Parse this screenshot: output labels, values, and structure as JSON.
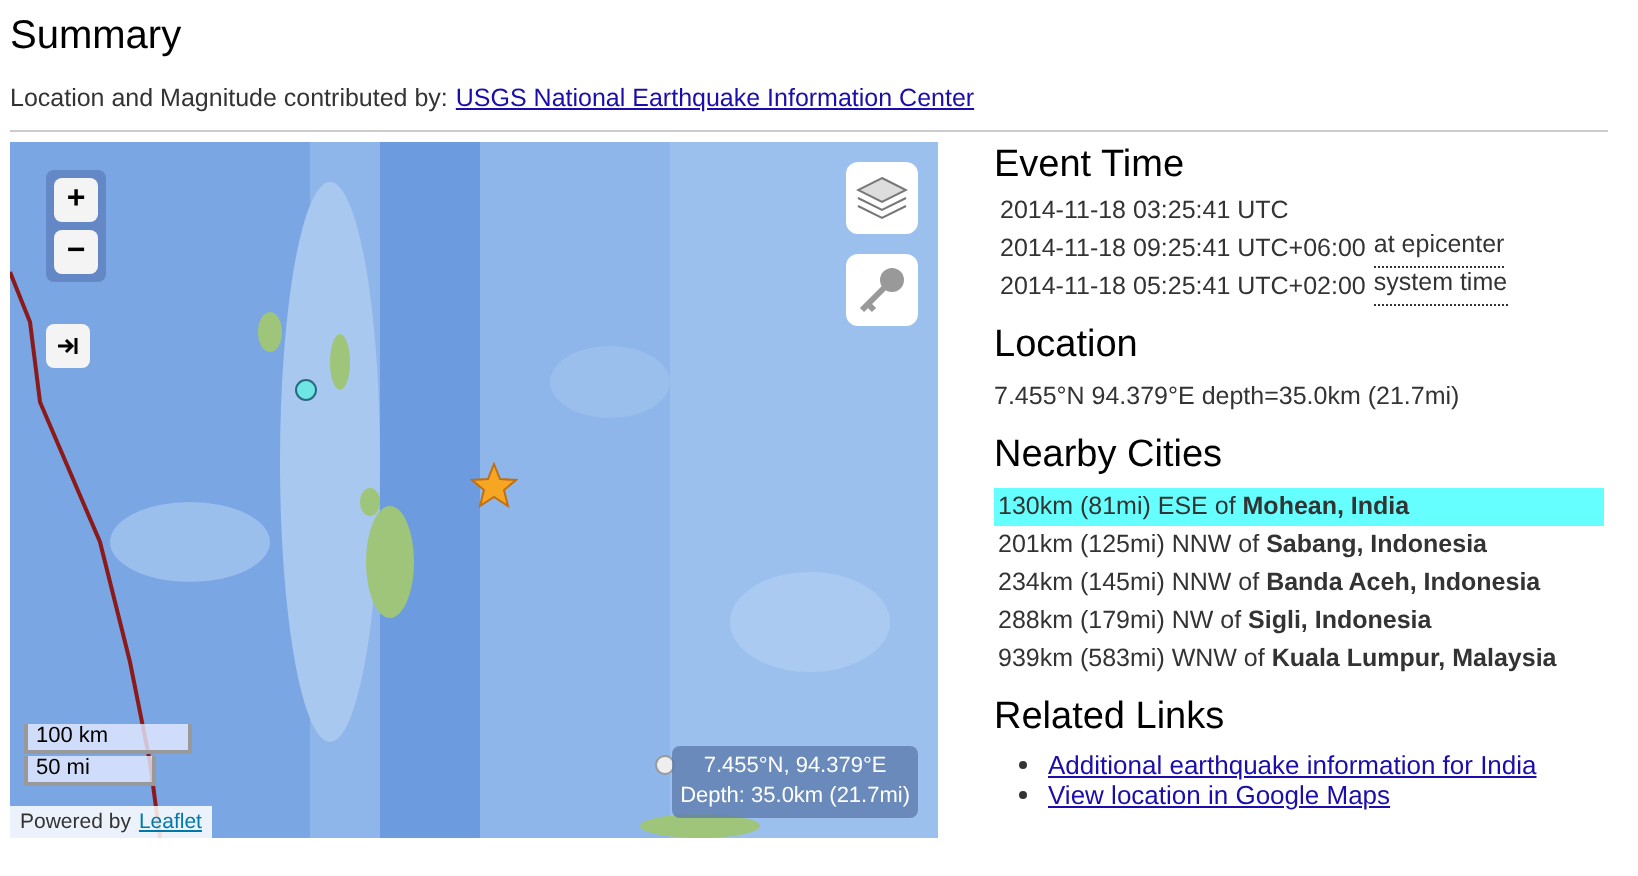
{
  "title": "Summary",
  "contributor": {
    "label": "Location and Magnitude contributed by:",
    "link": "USGS National Earthquake Information Center"
  },
  "map": {
    "kind": "picture",
    "zoom_in": "+",
    "zoom_out": "−",
    "scale": [
      "100 km",
      "50 mi"
    ],
    "attribution": {
      "label": "Powered by",
      "link": "Leaflet"
    },
    "popup": [
      "7.455°N, 94.379°E",
      "Depth: 35.0km (21.7mi)"
    ]
  },
  "event_time": {
    "heading": "Event Time",
    "rows": [
      {
        "time": "2014-11-18 03:25:41 UTC"
      },
      {
        "time": "2014-11-18 09:25:41 UTC+06:00",
        "note": "at epicenter"
      },
      {
        "time": "2014-11-18 05:25:41 UTC+02:00",
        "note": "system time"
      }
    ]
  },
  "location": {
    "heading": "Location",
    "text": "7.455°N 94.379°E depth=35.0km (21.7mi)"
  },
  "nearby_cities": {
    "heading": "Nearby Cities",
    "items": [
      {
        "text": "130km (81mi) ESE of **Mohean, India**",
        "selected": true
      },
      {
        "text": "201km (125mi) NNW of **Sabang, Indonesia**",
        "selected": false
      },
      {
        "text": "234km (145mi) NNW of **Banda Aceh, Indonesia**",
        "selected": false
      },
      {
        "text": "288km (179mi) NW of **Sigli, Indonesia**",
        "selected": false
      },
      {
        "text": "939km (583mi) WNW of **Kuala Lumpur, Malaysia**",
        "selected": false
      }
    ]
  },
  "related_links": {
    "heading": "Related Links",
    "links": [
      "Additional earthquake information for India",
      "View location in Google Maps"
    ]
  }
}
